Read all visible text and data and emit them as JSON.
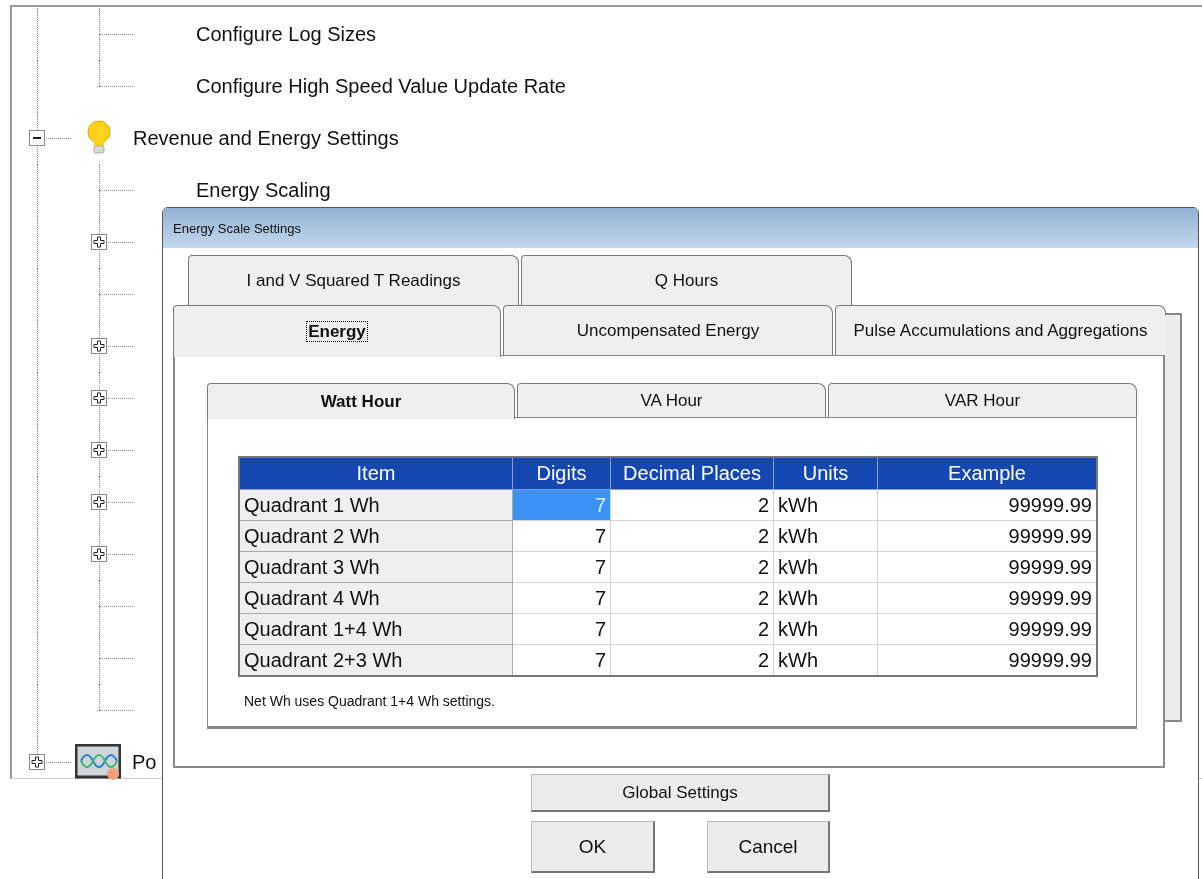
{
  "tree": {
    "continued": [
      {
        "kind": "leaf",
        "label": "Configure Log Sizes"
      },
      {
        "kind": "leaf",
        "label": "Configure High Speed Value Update Rate"
      }
    ],
    "nodes": [
      {
        "kind": "bulb",
        "label": "Revenue and Energy Settings",
        "expanded": true,
        "children": [
          {
            "kind": "leaf",
            "label": "Energy Scaling"
          },
          {
            "kind": "folder",
            "expanded": false
          },
          {
            "kind": "leaf"
          },
          {
            "kind": "folder",
            "expanded": false
          },
          {
            "kind": "folder",
            "expanded": false
          },
          {
            "kind": "folder",
            "expanded": false
          },
          {
            "kind": "folder",
            "expanded": false
          },
          {
            "kind": "folder",
            "expanded": false
          },
          {
            "kind": "leaf"
          },
          {
            "kind": "leaf"
          },
          {
            "kind": "leaf"
          }
        ]
      },
      {
        "kind": "scope",
        "label": "Po",
        "expanded": false
      }
    ]
  },
  "dialog": {
    "title": "Energy Scale Settings",
    "tab_rows": [
      [
        {
          "label": "I and V Squared T Readings",
          "selected": false
        },
        {
          "label": "Q Hours",
          "selected": false
        }
      ],
      [
        {
          "label": "Energy",
          "selected": true
        },
        {
          "label": "Uncompensated Energy",
          "selected": false
        },
        {
          "label": "Pulse Accumulations and Aggregations",
          "selected": false
        }
      ]
    ],
    "sub_tabs": [
      {
        "label": "Watt Hour",
        "selected": true
      },
      {
        "label": "VA Hour",
        "selected": false
      },
      {
        "label": "VAR Hour",
        "selected": false
      }
    ],
    "table": {
      "columns": [
        "Item",
        "Digits",
        "Decimal Places",
        "Units",
        "Example"
      ],
      "rows": [
        {
          "item": "Quadrant 1 Wh",
          "digits": "7",
          "digits_selected": true,
          "decimal_places": "2",
          "units": "kWh",
          "example": "99999.99"
        },
        {
          "item": "Quadrant 2 Wh",
          "digits": "7",
          "digits_selected": false,
          "decimal_places": "2",
          "units": "kWh",
          "example": "99999.99"
        },
        {
          "item": "Quadrant 3 Wh",
          "digits": "7",
          "digits_selected": false,
          "decimal_places": "2",
          "units": "kWh",
          "example": "99999.99"
        },
        {
          "item": "Quadrant 4 Wh",
          "digits": "7",
          "digits_selected": false,
          "decimal_places": "2",
          "units": "kWh",
          "example": "99999.99"
        },
        {
          "item": "Quadrant 1+4 Wh",
          "digits": "7",
          "digits_selected": false,
          "decimal_places": "2",
          "units": "kWh",
          "example": "99999.99"
        },
        {
          "item": "Quadrant 2+3 Wh",
          "digits": "7",
          "digits_selected": false,
          "decimal_places": "2",
          "units": "kWh",
          "example": "99999.99"
        }
      ]
    },
    "note": "Net Wh uses Quadrant 1+4 Wh settings.",
    "buttons": {
      "global": "Global Settings",
      "ok": "OK",
      "cancel": "Cancel"
    }
  }
}
